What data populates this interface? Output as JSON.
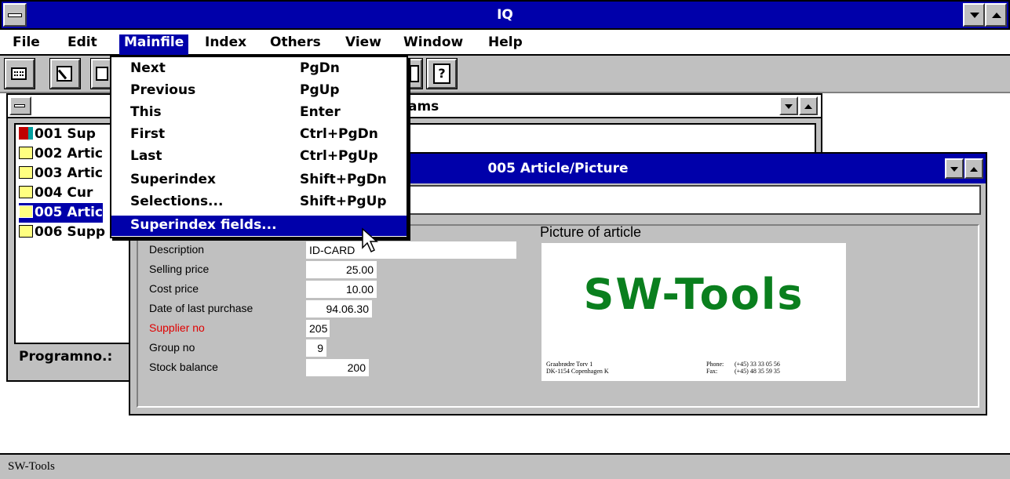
{
  "app": {
    "title": "IQ"
  },
  "menu": {
    "items": [
      {
        "label": "File"
      },
      {
        "label": "Edit"
      },
      {
        "label": "Mainfile"
      },
      {
        "label": "Index"
      },
      {
        "label": "Others"
      },
      {
        "label": "View"
      },
      {
        "label": "Window"
      },
      {
        "label": "Help"
      }
    ]
  },
  "dropdown": {
    "items": [
      {
        "label": "Next",
        "key": "PgDn"
      },
      {
        "label": "Previous",
        "key": "PgUp"
      },
      {
        "label": "This",
        "key": "Enter"
      },
      {
        "label": "First",
        "key": "Ctrl+PgDn"
      },
      {
        "label": "Last",
        "key": "Ctrl+PgUp"
      },
      {
        "label": "Superindex",
        "key": "Shift+PgDn"
      },
      {
        "label": "Selections...",
        "key": "Shift+PgUp"
      },
      {
        "label": "Superindex fields...",
        "key": ""
      }
    ]
  },
  "toolbar": {
    "icons": [
      "calculator-icon",
      "edit-icon",
      "save-icon",
      "document-icon",
      "help-icon"
    ],
    "help_glyph": "?"
  },
  "programs_window": {
    "title_fragment": "ams",
    "items": [
      {
        "label": "001  Sup"
      },
      {
        "label": "002  Artic"
      },
      {
        "label": "003  Artic"
      },
      {
        "label": "004  Cur"
      },
      {
        "label": "005  Artic"
      },
      {
        "label": "006  Supp"
      }
    ],
    "selected_index": 4,
    "programno_label": "Programno.:"
  },
  "article_window": {
    "title": "005  Article/Picture",
    "fields": [
      {
        "label": "Description",
        "value": "ID-CARD",
        "label_color": "black"
      },
      {
        "label": "Selling price",
        "value": "25.00",
        "label_color": "black"
      },
      {
        "label": "Cost price",
        "value": "10.00",
        "label_color": "black"
      },
      {
        "label": "Date of last purchase",
        "value": "94.06.30",
        "label_color": "black"
      },
      {
        "label": "Supplier no",
        "value": "205",
        "label_color": "#e00000"
      },
      {
        "label": "Group no",
        "value": "9",
        "label_color": "black"
      },
      {
        "label": "Stock balance",
        "value": "200",
        "label_color": "black"
      }
    ],
    "picture_label": "Picture of article",
    "picture": {
      "logo_text": "SW-Tools",
      "address_line1": "Graabrødre Torv 1",
      "address_line2": "DK-1154 Copenhagen K",
      "phone_label": "Phone:",
      "phone_value": "(+45) 33 33 05 56",
      "fax_label": "Fax:",
      "fax_value": "(+45) 48 35 59 35"
    }
  },
  "statusbar": {
    "text": "SW-Tools"
  },
  "colors": {
    "titlebar": "#0000aa",
    "window_bg": "#c0c0c0",
    "logo_green": "#0a7f1e",
    "highlight": "#0000aa"
  }
}
